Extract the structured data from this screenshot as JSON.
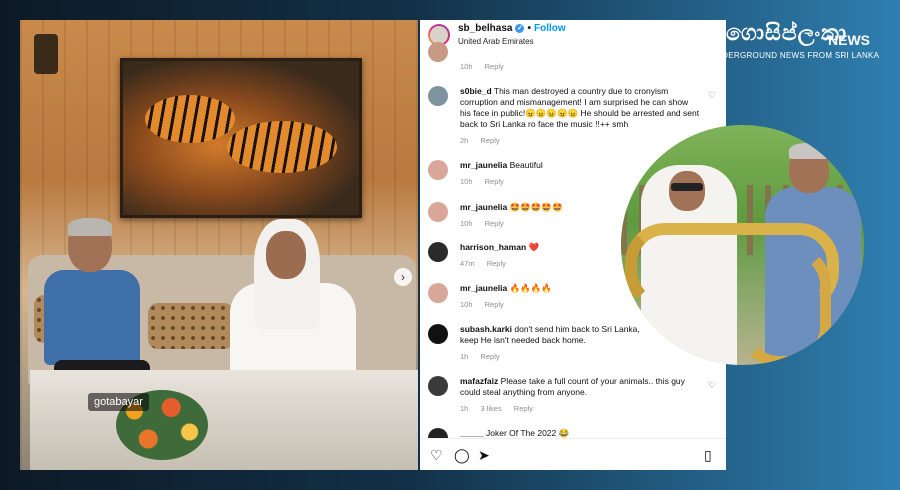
{
  "photo_left": {
    "tag": "gotabayar",
    "next_icon": "chevron-right-icon"
  },
  "instagram": {
    "header": {
      "username": "sb_belhasa",
      "verified_glyph": "✓",
      "separator": "•",
      "follow_label": "Follow",
      "location": "United Arab Emirates"
    },
    "comments": [
      {
        "user": "",
        "text": "",
        "time": "10h",
        "reply": "Reply",
        "likes": ""
      },
      {
        "user": "s0bie_d",
        "text": "This man destroyed a country due to cronyism corruption and mismanagement! I am surprised he can show his face in public!😠😠😠😠😠 He should be arrested and sent back to Sri Lanka ro face the music !!++ smh",
        "time": "2h",
        "reply": "Reply",
        "likes": ""
      },
      {
        "user": "mr_jaunelia",
        "text": "Beautiful",
        "time": "10h",
        "reply": "Reply",
        "likes": ""
      },
      {
        "user": "mr_jaunelia",
        "text": "🤩🤩🤩🤩🤩",
        "time": "10h",
        "reply": "Reply",
        "likes": ""
      },
      {
        "user": "harrison_haman",
        "text": "❤️",
        "time": "47m",
        "reply": "Reply",
        "likes": ""
      },
      {
        "user": "mr_jaunelia",
        "text": "🔥🔥🔥🔥",
        "time": "10h",
        "reply": "Reply",
        "likes": ""
      },
      {
        "user": "subash.karki",
        "text": "don't send him back to Sri Lanka, keep He isn't needed back home.",
        "time": "1h",
        "reply": "Reply",
        "likes": ""
      },
      {
        "user": "mafazfaiz",
        "text": "Please take a full count of your animals.. this guy could steal anything from anyone.",
        "time": "1h",
        "reply": "Reply",
        "likes": "3 likes"
      },
      {
        "user": "_____",
        "text": "Joker Of The 2022 😂",
        "time": "",
        "reply": "",
        "likes": ""
      }
    ],
    "actions": {
      "like_icon": "heart-icon",
      "comment_icon": "comment-icon",
      "share_icon": "send-icon",
      "save_icon": "bookmark-icon",
      "like_glyph": "♡",
      "comment_glyph": "◯",
      "share_glyph": "➤",
      "save_glyph": "▯"
    },
    "comment_like_glyph": "♡"
  },
  "logo": {
    "title": "ගොසිප්ලංකා",
    "news": "NEWS",
    "subtitle": "UNDERGROUND NEWS FROM SRI LANKA"
  },
  "colors": {
    "follow": "#0095f6",
    "background_dark": "#0d1a26",
    "background_light": "#2f7fb0"
  }
}
